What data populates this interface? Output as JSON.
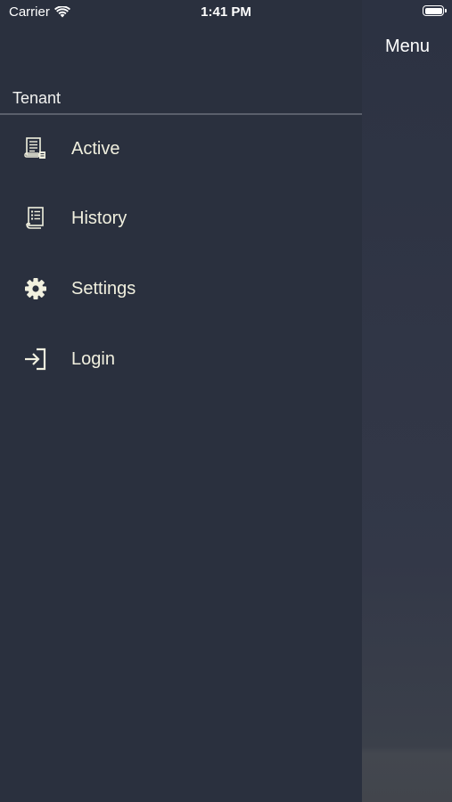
{
  "status_bar": {
    "carrier": "Carrier",
    "time": "1:41 PM"
  },
  "nav": {
    "menu_label": "Menu"
  },
  "drawer": {
    "header": "Tenant",
    "items": [
      {
        "label": "Active",
        "icon": "contract-active-icon"
      },
      {
        "label": "History",
        "icon": "history-scroll-icon"
      },
      {
        "label": "Settings",
        "icon": "gear-icon"
      },
      {
        "label": "Login",
        "icon": "login-icon"
      }
    ]
  },
  "colors": {
    "drawer_background": "#2a303e",
    "menu_text": "#f1f0df",
    "icon_color": "#f1f0df",
    "divider": "#5a5f6b"
  }
}
